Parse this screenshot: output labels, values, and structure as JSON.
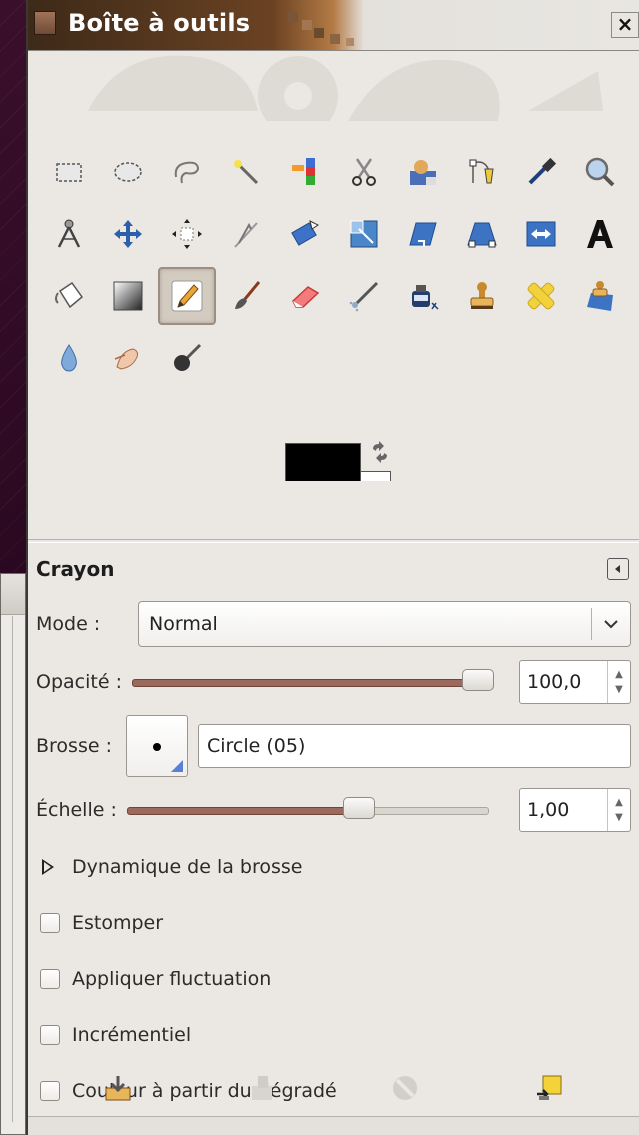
{
  "window": {
    "title": "Boîte à outils",
    "close_symbol": "×"
  },
  "tools": [
    {
      "name": "rect-select-icon"
    },
    {
      "name": "ellipse-select-icon"
    },
    {
      "name": "free-select-icon"
    },
    {
      "name": "fuzzy-select-icon"
    },
    {
      "name": "select-by-color-icon"
    },
    {
      "name": "scissors-select-icon"
    },
    {
      "name": "foreground-select-icon"
    },
    {
      "name": "paths-icon"
    },
    {
      "name": "color-picker-icon"
    },
    {
      "name": "zoom-icon"
    },
    {
      "name": "measure-icon"
    },
    {
      "name": "move-icon"
    },
    {
      "name": "align-icon"
    },
    {
      "name": "crop-icon"
    },
    {
      "name": "rotate-icon"
    },
    {
      "name": "scale-icon"
    },
    {
      "name": "shear-icon"
    },
    {
      "name": "perspective-icon"
    },
    {
      "name": "flip-icon"
    },
    {
      "name": "text-icon"
    },
    {
      "name": "bucket-fill-icon"
    },
    {
      "name": "blend-icon"
    },
    {
      "name": "pencil-icon",
      "active": true
    },
    {
      "name": "paintbrush-icon"
    },
    {
      "name": "eraser-icon"
    },
    {
      "name": "airbrush-icon"
    },
    {
      "name": "ink-icon"
    },
    {
      "name": "clone-icon"
    },
    {
      "name": "heal-icon"
    },
    {
      "name": "perspective-clone-icon"
    },
    {
      "name": "blur-sharpen-icon"
    },
    {
      "name": "smudge-icon"
    },
    {
      "name": "dodge-burn-icon"
    }
  ],
  "colors": {
    "foreground": "#000000",
    "background": "#ffffff"
  },
  "options": {
    "title": "Crayon",
    "mode": {
      "label": "Mode :",
      "value": "Normal"
    },
    "opacity": {
      "label": "Opacité :",
      "value": "100,0",
      "fraction": 1.0
    },
    "brush": {
      "label": "Brosse :",
      "value": "Circle (05)"
    },
    "scale": {
      "label": "Échelle :",
      "value": "1,00",
      "fraction": 0.64
    },
    "dynamics_label": "Dynamique de la brosse",
    "checks": [
      {
        "label": "Estomper",
        "checked": false
      },
      {
        "label": "Appliquer fluctuation",
        "checked": false
      },
      {
        "label": "Incrémentiel",
        "checked": false
      },
      {
        "label": "Couleur à partir du dégradé",
        "checked": false
      }
    ]
  },
  "bottom_buttons": [
    "save-options-icon",
    "restore-options-icon",
    "delete-options-icon",
    "reset-options-icon"
  ]
}
